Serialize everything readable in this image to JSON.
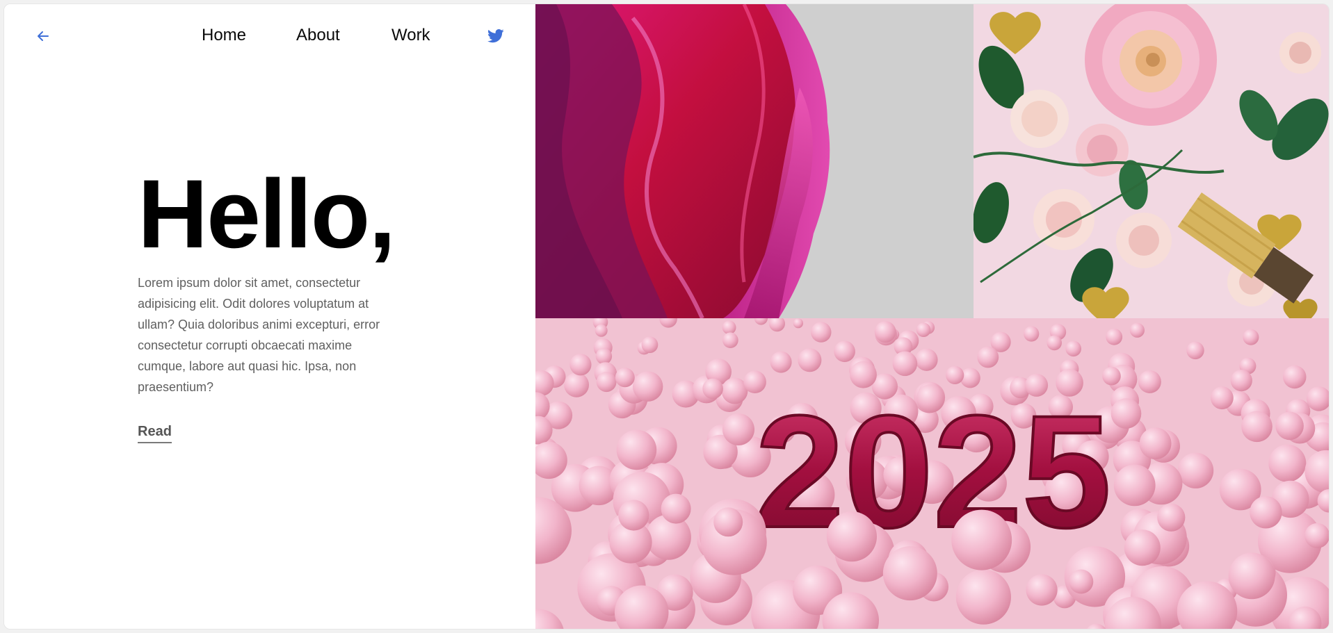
{
  "nav": {
    "back_icon": "arrow-left-icon",
    "items": [
      {
        "label": "Home"
      },
      {
        "label": "About"
      },
      {
        "label": "Work"
      }
    ],
    "social_icon": "twitter-icon"
  },
  "hero": {
    "title": "Hello,",
    "body": "Lorem ipsum dolor sit amet, consectetur adipisicing elit. Odit dolores voluptatum at ullam? Quia doloribus animi excepturi, error consectetur corrupti obcaecati maxime cumque, labore aut quasi hic. Ipsa, non praesentium?",
    "read_label": "Read"
  },
  "gallery": {
    "tiles": [
      {
        "name": "pink silk ribbon photo"
      },
      {
        "name": "roses and gold hearts photo"
      },
      {
        "name": "2025 balloon numbers photo",
        "text": "2025"
      }
    ]
  },
  "colors": {
    "accent": "#3f6fd8",
    "title": "#000000",
    "body": "#5f5f5f",
    "silk_magenta": "#c2185b",
    "pink_bg": "#f1bfd0"
  }
}
